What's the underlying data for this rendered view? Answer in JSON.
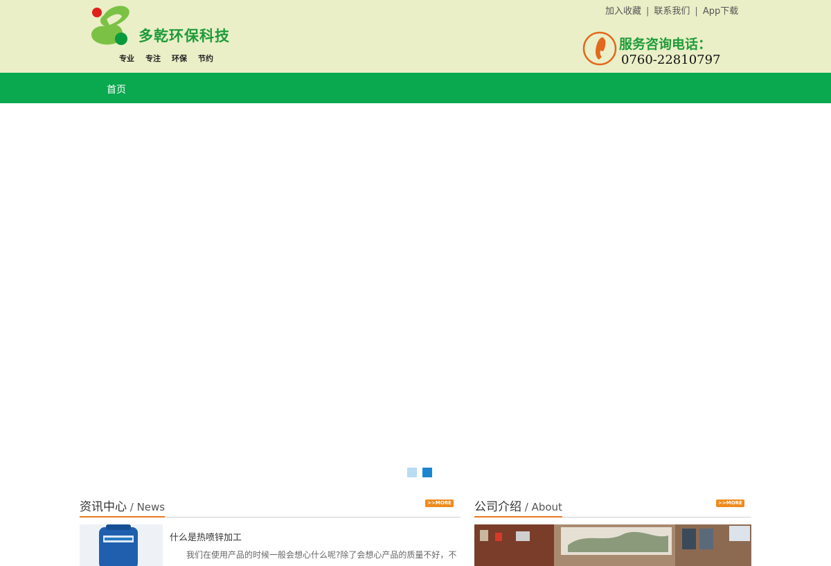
{
  "brand": {
    "name": "多乾环保科技",
    "tagline": [
      "专业",
      "专注",
      "环保",
      "节约"
    ]
  },
  "toplinks": [
    {
      "label": "加入收藏"
    },
    {
      "label": "联系我们"
    },
    {
      "label": "App下载"
    }
  ],
  "contact": {
    "label": "服务咨询电话：",
    "number": "0760-22810797"
  },
  "nav": {
    "items": [
      {
        "label": "首页"
      }
    ]
  },
  "carousel": {
    "active_index": 2,
    "count": 2
  },
  "news": {
    "title_cn": "资讯中心",
    "title_en": " / News",
    "more_label": ">>MORE",
    "item": {
      "title": "什么是热喷锌加工",
      "excerpt": "我们在使用产品的时候一般会想心什么呢?除了会想心产品的质量不好，不"
    }
  },
  "about": {
    "title_cn": "公司介绍",
    "title_en": " / About",
    "more_label": ">>MORE"
  },
  "colors": {
    "header_bg": "#eaefc7",
    "nav_bg": "#0aa84f",
    "accent_orange": "#e87722",
    "brand_green": "#1e9b3a"
  }
}
